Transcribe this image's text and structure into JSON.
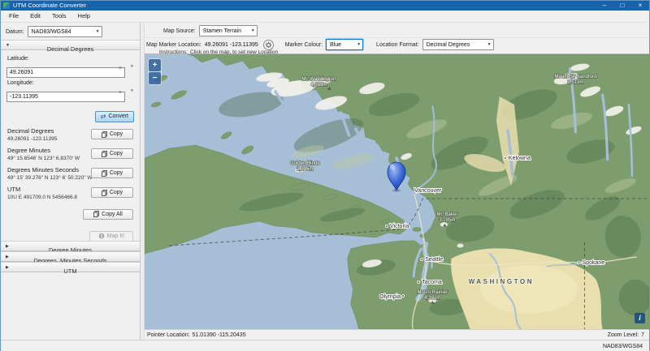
{
  "window": {
    "title": "UTM Coordinate Converter",
    "minimize": "–",
    "maximize": "□",
    "close": "×"
  },
  "menu": {
    "items": [
      "File",
      "Edit",
      "Tools",
      "Help"
    ]
  },
  "datum": {
    "label": "Datum:",
    "value": "NAD83/WGS84"
  },
  "icons": {
    "expanded": "▼",
    "collapsed": "▶",
    "convert": "⇄",
    "clear": "×",
    "degree": "°",
    "zoom_in": "+",
    "zoom_out": "−",
    "info": "i",
    "dropdown": "▼"
  },
  "sidebar": {
    "expanded_section": "Decimal Degrees",
    "latitude_label": "Latitude:",
    "latitude_value": "49.26091",
    "longitude_label": "Longitude:",
    "longitude_value": "-123.11395",
    "convert_label": "Convert",
    "results": [
      {
        "name": "Decimal Degrees",
        "value": "49.26091 -123.11395"
      },
      {
        "name": "Degree Minutes",
        "value": "49° 15.6546' N 123° 6.8370' W"
      },
      {
        "name": "Degrees Minutes Seconds",
        "value": "49° 15' 39.276\" N 123° 6' 50.220\" W"
      },
      {
        "name": "UTM",
        "value": "10U E 491709.0 N 5456466.8"
      }
    ],
    "copy_label": "Copy",
    "copy_all_label": "Copy All",
    "map_it_label": "Map It!",
    "collapsed_sections": [
      "Degree Minutes",
      "Degrees, Minutes Seconds",
      "UTM"
    ]
  },
  "map_toolbar": {
    "map_source_label": "Map Source:",
    "map_source_value": "Stamen Terrain",
    "marker_location_label": "Map Marker Location:",
    "marker_location_value": "49.26091 -123.11395",
    "marker_colour_label": "Marker Colour:",
    "marker_colour_value": "Blue",
    "location_format_label": "Location Format:",
    "location_format_value": "Decimal Degrees",
    "instructions_label": "Instructions:",
    "instructions_text": "Click on the map, to set new Location"
  },
  "map": {
    "cities": {
      "vancouver": "Vancouver",
      "victoria": "Victoria",
      "seattle": "Seattle",
      "tacoma": "Tacoma",
      "olympia": "Olympia",
      "kelowna": "Kelowna",
      "spokane": "Spokane"
    },
    "region": "WASHINGTON",
    "peaks": {
      "waddington": {
        "name": "Mt. Waddington",
        "elev": "4,019m"
      },
      "golden_hinde": {
        "name": "Golden Hinde",
        "elev": "2,195m"
      },
      "sir_sandford": {
        "name": "Mount Sir Sandford",
        "elev": "3,519m"
      },
      "baker": {
        "name": "Mt. Baker",
        "elev": "3,285m"
      },
      "rainier": {
        "name": "Mount Rainier",
        "elev": "4,392m"
      }
    },
    "marker_colour": "#2e5fd3"
  },
  "statusbar": {
    "pointer_label": "Pointer Location:",
    "pointer_value": "51.01390 -115.20435",
    "zoom_label": "Zoom Level:",
    "zoom_value": "7",
    "datum_value": "NAD83/WGS84"
  },
  "colors": {
    "titlebar": "#1763ac",
    "accent": "#0078d7",
    "water": "#a6bfd7",
    "land": "#7e9d6f",
    "arid": "#e9dfae",
    "snow": "#f4f3ee"
  }
}
